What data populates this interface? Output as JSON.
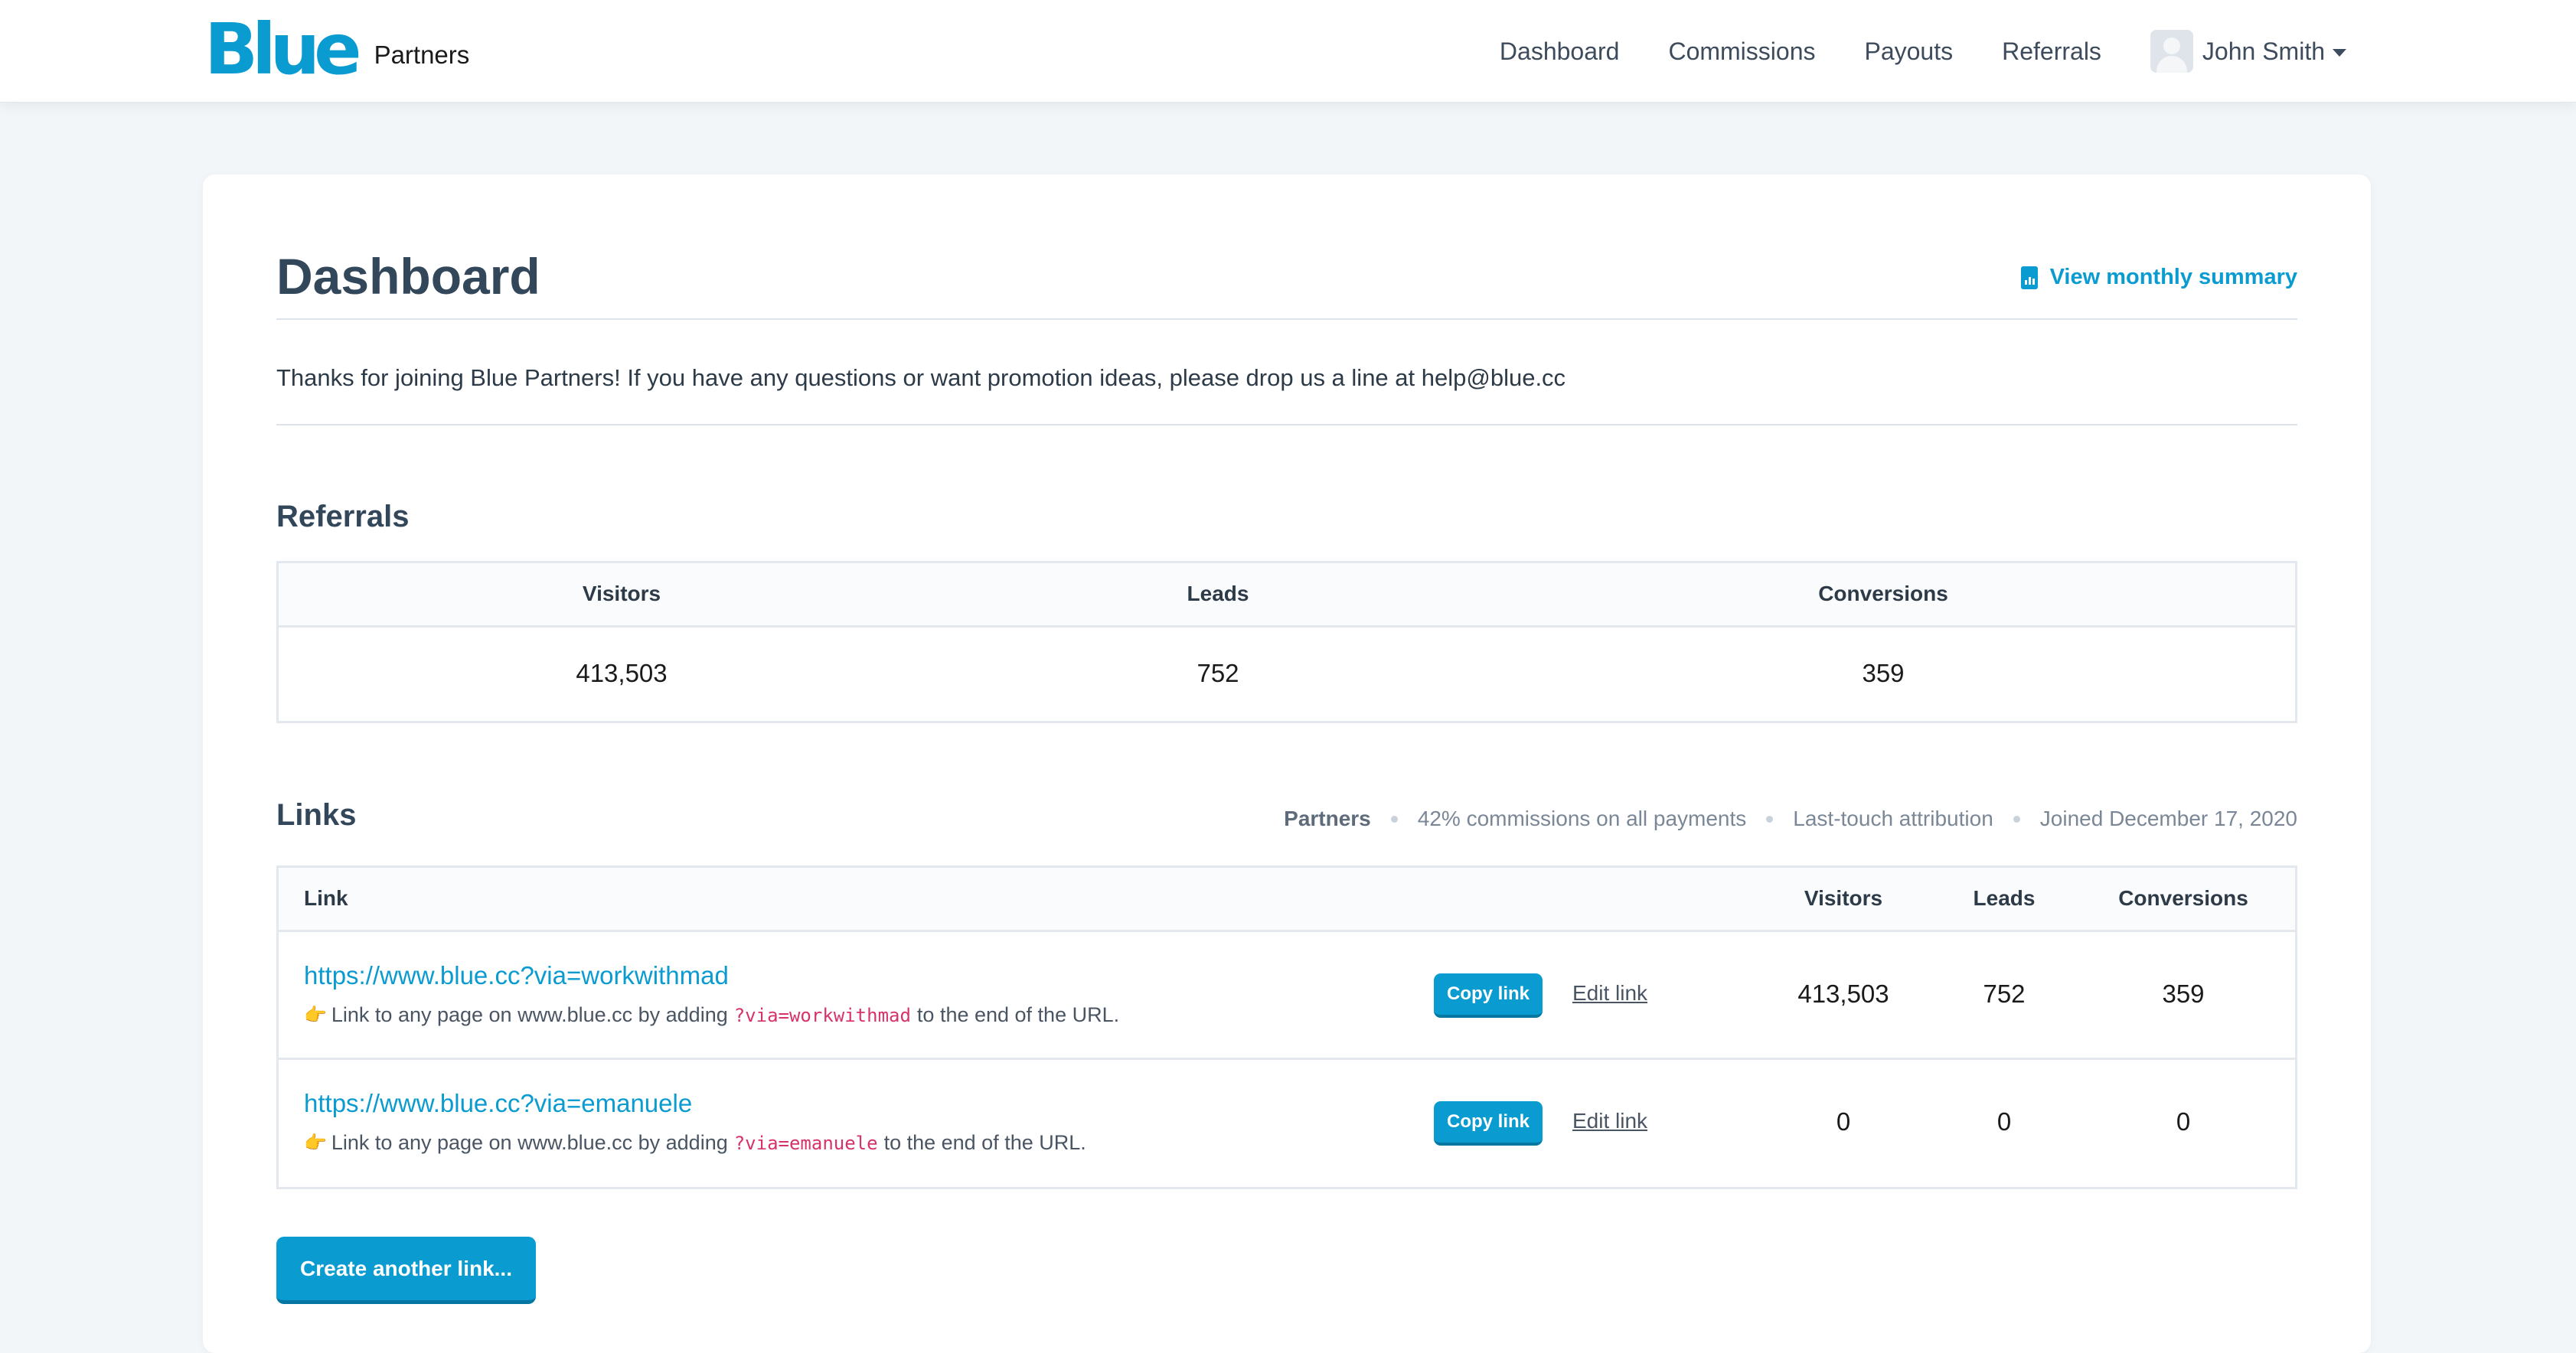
{
  "navbar": {
    "brand": "Blue",
    "brand_sub": "Partners",
    "links": [
      "Dashboard",
      "Commissions",
      "Payouts",
      "Referrals"
    ],
    "user_name": "John Smith"
  },
  "page": {
    "title": "Dashboard",
    "summary_link": "View monthly summary",
    "intro": "Thanks for joining Blue Partners! If you have any questions or want promotion ideas, please drop us a line at help@blue.cc"
  },
  "referrals": {
    "title": "Referrals",
    "headers": [
      "Visitors",
      "Leads",
      "Conversions"
    ],
    "values": [
      "413,503",
      "752",
      "359"
    ]
  },
  "links": {
    "title": "Links",
    "meta": {
      "program": "Partners",
      "commission": "42% commissions on all payments",
      "attribution": "Last-touch attribution",
      "joined": "Joined December 17, 2020"
    },
    "headers": {
      "link": "Link",
      "visitors": "Visitors",
      "leads": "Leads",
      "conversions": "Conversions"
    },
    "rows": [
      {
        "url": "https://www.blue.cc?via=workwithmad",
        "hint_prefix": "Link to any page on www.blue.cc by adding",
        "code": "?via=workwithmad",
        "hint_suffix": "to the end of the URL.",
        "copy_label": "Copy link",
        "edit_label": "Edit link",
        "visitors": "413,503",
        "leads": "752",
        "conversions": "359"
      },
      {
        "url": "https://www.blue.cc?via=emanuele",
        "hint_prefix": "Link to any page on www.blue.cc by adding",
        "code": "?via=emanuele",
        "hint_suffix": "to the end of the URL.",
        "copy_label": "Copy link",
        "edit_label": "Edit link",
        "visitors": "0",
        "leads": "0",
        "conversions": "0"
      }
    ],
    "create_button": "Create another link..."
  },
  "icons": {
    "summary": "document-chart-icon",
    "hint": "pointing-hand-icon",
    "avatar": "user-avatar-icon",
    "caret": "caret-down-icon"
  },
  "colors": {
    "accent": "#0a9bd0",
    "code": "#d6336c",
    "background": "#f3f6f9"
  }
}
